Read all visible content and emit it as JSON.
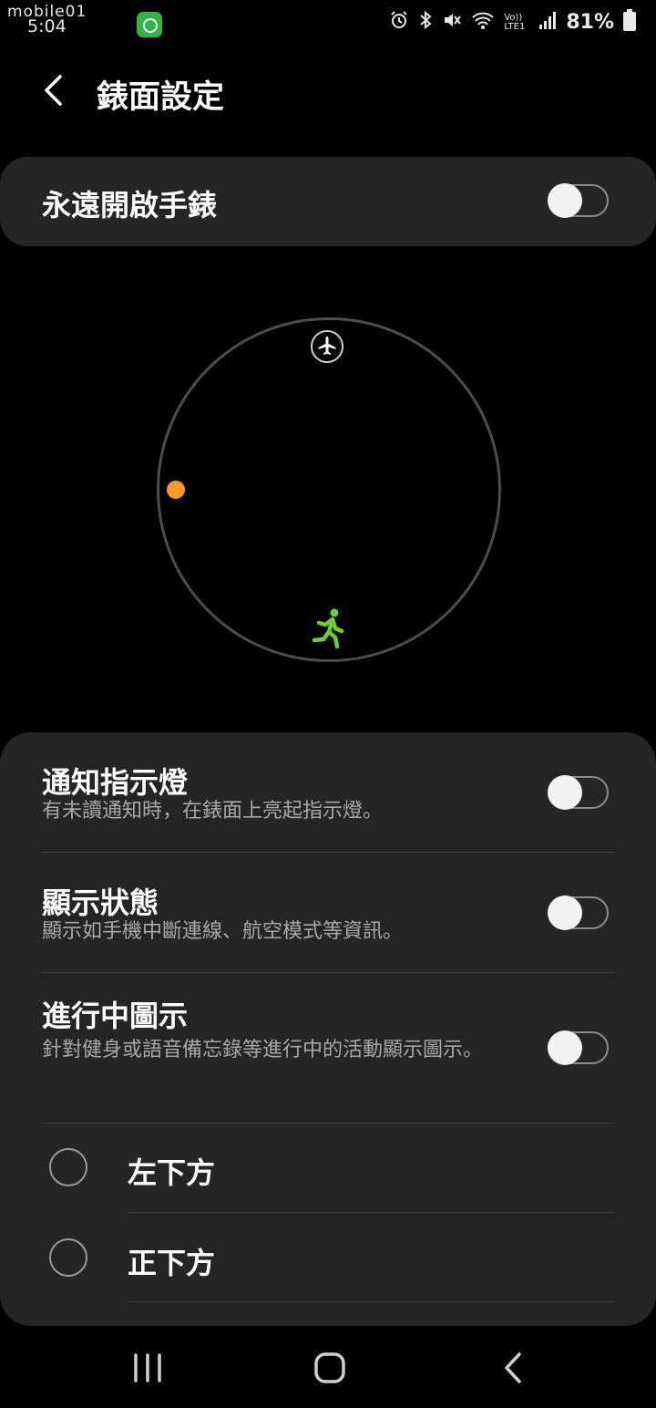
{
  "status_bar": {
    "logo_text": "mobile01",
    "time": "5:04",
    "icons": [
      "alarm-icon",
      "bluetooth-icon",
      "mute-icon",
      "wifi-icon",
      "volte-icon",
      "signal-icon"
    ],
    "volte_label": "Vo)) LTE1",
    "battery": "81%"
  },
  "header": {
    "title": "錶面設定",
    "back_icon": "chevron-left-icon"
  },
  "aod": {
    "label": "永遠開啟手錶",
    "enabled": false
  },
  "preview": {
    "top_icon": "airplane-icon",
    "left_indicator_color": "#f59a23",
    "bottom_icon": "running-icon",
    "bottom_icon_color": "#6ad22a"
  },
  "settings": [
    {
      "title": "通知指示燈",
      "subtitle": "有未讀通知時，在錶面上亮起指示燈。",
      "enabled": false
    },
    {
      "title": "顯示狀態",
      "subtitle": "顯示如手機中斷連線、航空模式等資訊。",
      "enabled": false
    },
    {
      "title": "進行中圖示",
      "subtitle": "針對健身或語音備忘錄等進行中的活動顯示圖示。",
      "enabled": false
    }
  ],
  "position_options": [
    {
      "label": "左下方",
      "selected": false
    },
    {
      "label": "正下方",
      "selected": false
    }
  ],
  "nav": [
    "recents-icon",
    "home-icon",
    "back-icon"
  ]
}
